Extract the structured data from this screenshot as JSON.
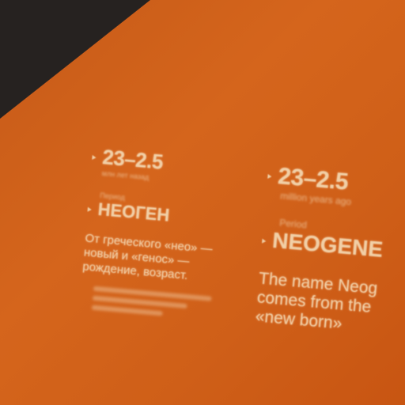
{
  "russian": {
    "date": "23–2.5",
    "date_unit": "млн лет назад",
    "label": "Период",
    "title": "НЕОГЕН",
    "body": "От греческого «нео» — новый и «генос» — рождение, возраст."
  },
  "english": {
    "date": "23–2.5",
    "date_unit": "million years ago",
    "label": "Period",
    "title": "NEOGENE",
    "body_lines": [
      "The name Neog",
      "comes from the",
      "«new born»"
    ]
  },
  "colors": {
    "panel": "#d5651c",
    "background": "#262220",
    "text": "#f1cfa6"
  }
}
